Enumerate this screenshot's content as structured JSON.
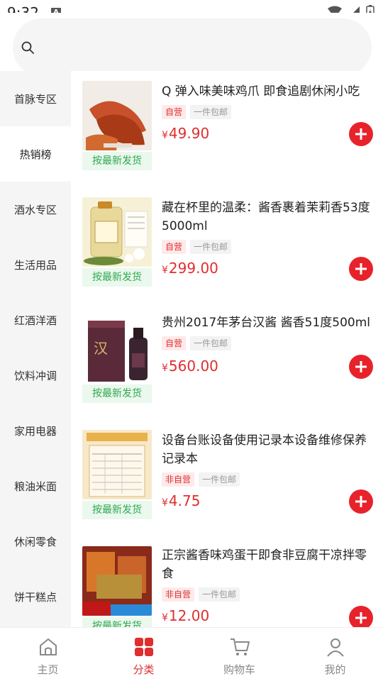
{
  "status": {
    "time": "9:32",
    "notif_icon": "A"
  },
  "search": {
    "placeholder": ""
  },
  "sidebar": {
    "items": [
      {
        "label": "首脉专区"
      },
      {
        "label": "热销榜"
      },
      {
        "label": "酒水专区"
      },
      {
        "label": "生活用品"
      },
      {
        "label": "红酒洋酒"
      },
      {
        "label": "饮料冲调"
      },
      {
        "label": "家用电器"
      },
      {
        "label": "粮油米面"
      },
      {
        "label": "休闲零食"
      },
      {
        "label": "饼干糕点"
      }
    ],
    "active_index": 1
  },
  "products": [
    {
      "title": "Q 弹入味美味鸡爪 即食追剧休闲小吃",
      "tag1": "自营",
      "tag2": "一件包邮",
      "currency": "¥",
      "price": "49.90",
      "ship": "按最新发货"
    },
    {
      "title": "藏在杯里的温柔：酱香裹着茉莉香53度5000ml",
      "tag1": "自营",
      "tag2": "一件包邮",
      "currency": "¥",
      "price": "299.00",
      "ship": "按最新发货"
    },
    {
      "title": "贵州2017年茅台汉酱 酱香51度500ml",
      "tag1": "自营",
      "tag2": "一件包邮",
      "currency": "¥",
      "price": "560.00",
      "ship": "按最新发货"
    },
    {
      "title": "设备台账设备使用记录本设备维修保养记录本",
      "tag1": "非自营",
      "tag2": "一件包邮",
      "currency": "¥",
      "price": "4.75",
      "ship": "按最新发货"
    },
    {
      "title": "正宗酱香味鸡蛋干即食非豆腐干凉拌零食",
      "tag1": "非自营",
      "tag2": "一件包邮",
      "currency": "¥",
      "price": "12.00",
      "ship": "按最新发货"
    }
  ],
  "tabbar": {
    "items": [
      {
        "label": "主页",
        "icon": "home-icon"
      },
      {
        "label": "分类",
        "icon": "category-icon"
      },
      {
        "label": "购物车",
        "icon": "cart-icon"
      },
      {
        "label": "我的",
        "icon": "user-icon"
      }
    ],
    "active_index": 1
  },
  "colors": {
    "accent": "#e02e2e",
    "ship_green": "#2fa84f",
    "sidebar_bg": "#f5f5f5"
  }
}
